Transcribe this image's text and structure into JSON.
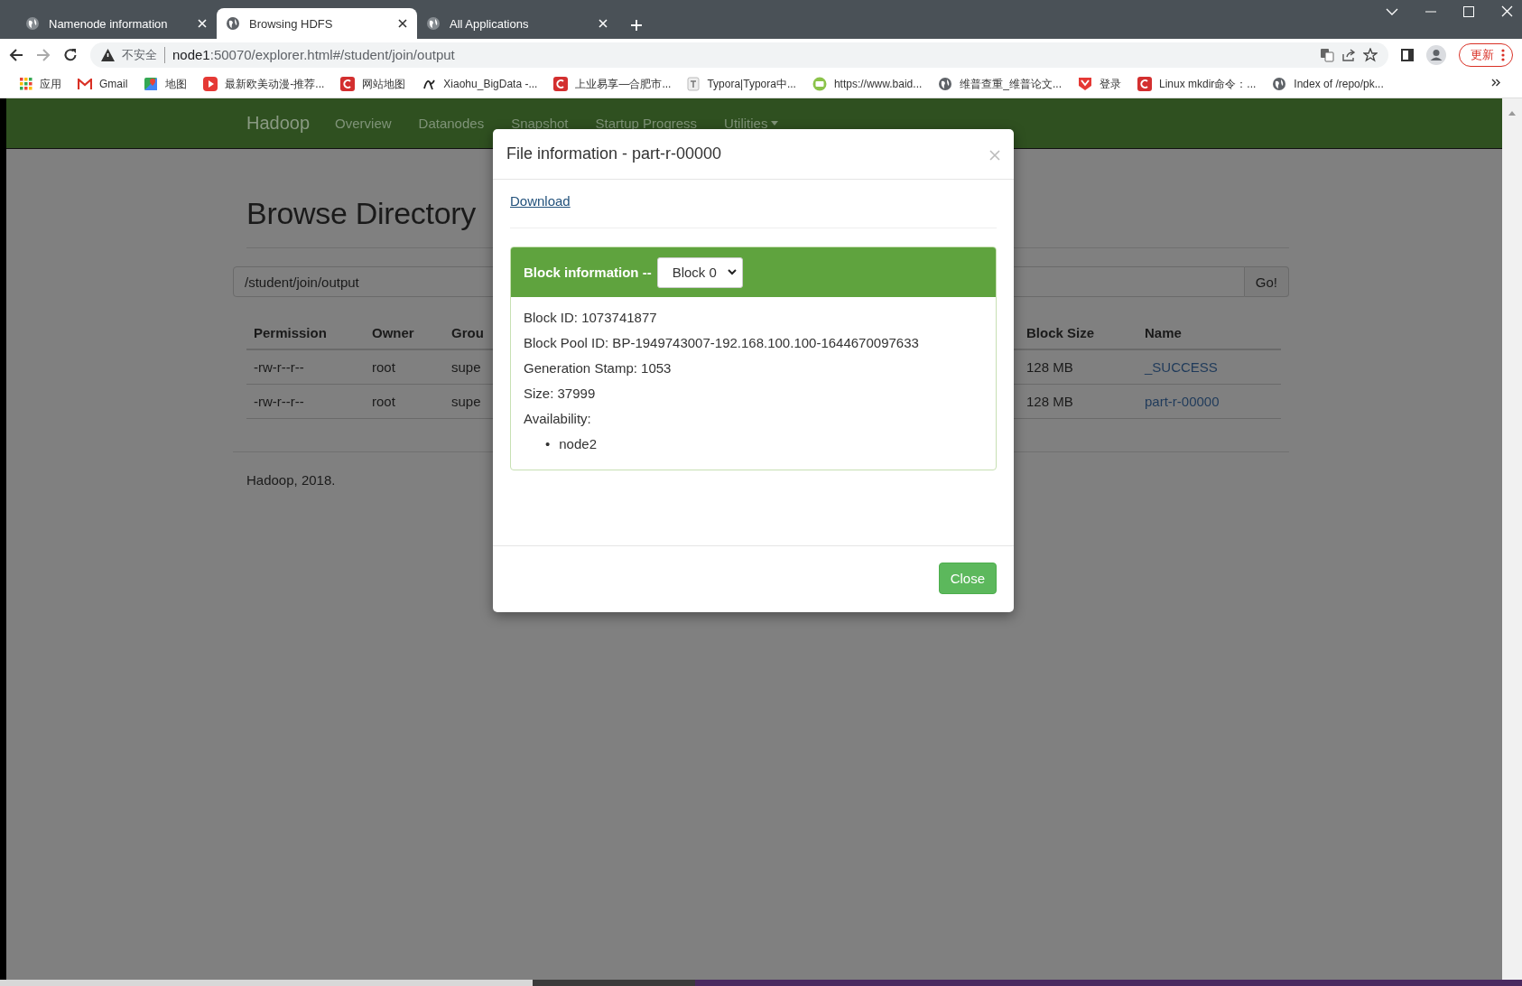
{
  "browser": {
    "tabs": [
      {
        "title": "Namenode information",
        "selected": false
      },
      {
        "title": "Browsing HDFS",
        "selected": true
      },
      {
        "title": "All Applications",
        "selected": false
      }
    ],
    "security_label": "不安全",
    "url_host": "node1",
    "url_path": ":50070/explorer.html#/student/join/output",
    "update_button": "更新",
    "bookmarks": [
      {
        "label": "应用",
        "kind": "grid"
      },
      {
        "label": "Gmail",
        "kind": "mail"
      },
      {
        "label": "地图",
        "kind": "map"
      },
      {
        "label": "最新欧美动漫-推荐...",
        "kind": "play"
      },
      {
        "label": "网站地图",
        "kind": "site"
      },
      {
        "label": "Xiaohu_BigData -...",
        "kind": "swirl"
      },
      {
        "label": "上业易享—合肥市...",
        "kind": "site"
      },
      {
        "label": "Typora|Typora中...",
        "kind": "doc"
      },
      {
        "label": "https://www.baid...",
        "kind": "badge"
      },
      {
        "label": "维普查重_维普论文...",
        "kind": "globe"
      },
      {
        "label": "登录",
        "kind": "shield"
      },
      {
        "label": "Linux mkdir命令：...",
        "kind": "site"
      },
      {
        "label": "Index of /repo/pk...",
        "kind": "globe"
      }
    ]
  },
  "navbar": {
    "brand": "Hadoop",
    "items": [
      {
        "label": "Overview",
        "dropdown": false
      },
      {
        "label": "Datanodes",
        "dropdown": false
      },
      {
        "label": "Snapshot",
        "dropdown": false
      },
      {
        "label": "Startup Progress",
        "dropdown": false
      },
      {
        "label": "Utilities",
        "dropdown": true
      }
    ]
  },
  "page": {
    "title": "Browse Directory",
    "path_value": "/student/join/output",
    "go_button": "Go!",
    "table": {
      "columns": [
        "Permission",
        "Owner",
        "Grou",
        "Block Size",
        "Name"
      ],
      "rows": [
        [
          "-rw-r--r--",
          "root",
          "supe",
          "128 MB",
          "_SUCCESS"
        ],
        [
          "-rw-r--r--",
          "root",
          "supe",
          "128 MB",
          "part-r-00000"
        ]
      ]
    },
    "footer": "Hadoop, 2018."
  },
  "modal": {
    "title": "File information - part-r-00000",
    "download_link": "Download",
    "panel_heading": "Block information --",
    "block_select": "Block 0",
    "details": [
      "Block ID: 1073741877",
      "Block Pool ID: BP-1949743007-192.168.100.100-1644670097633",
      "Generation Stamp: 1053",
      "Size: 37999",
      "Availability:"
    ],
    "availability": [
      "node2"
    ],
    "bullet": "•",
    "close_button": "Close"
  }
}
